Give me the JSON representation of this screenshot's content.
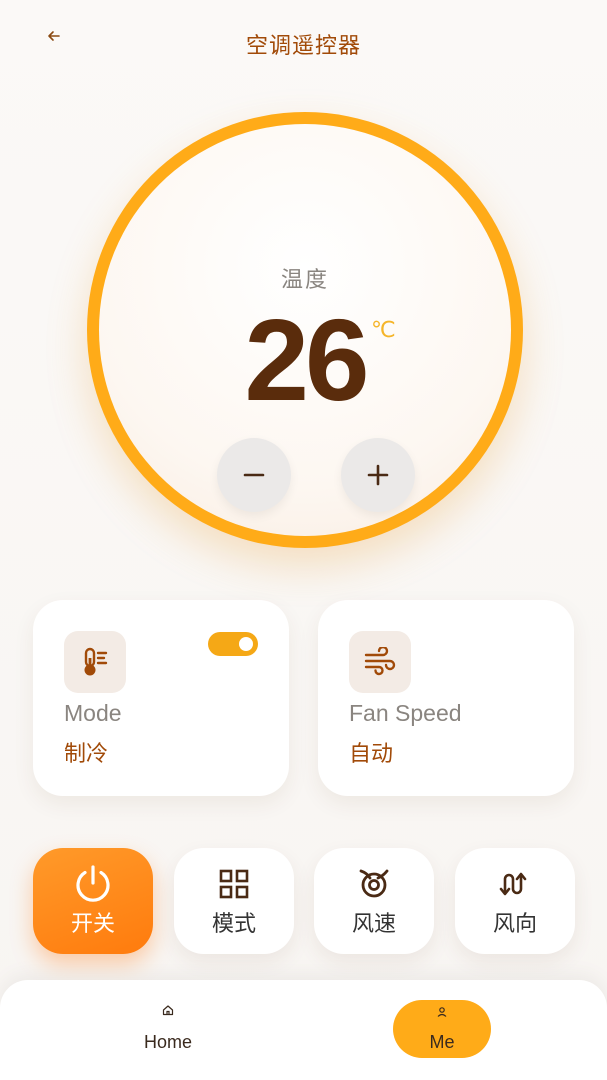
{
  "header": {
    "title": "空调遥控器",
    "back_icon": "arrow-left-icon"
  },
  "thermostat": {
    "label": "温度",
    "value": "26",
    "unit": "℃",
    "minus_label": "−",
    "plus_label": "+"
  },
  "cards": {
    "mode": {
      "title": "Mode",
      "value": "制冷",
      "icon": "thermometer-icon",
      "toggle_on": true
    },
    "fan_speed": {
      "title": "Fan Speed",
      "value": "自动",
      "icon": "wind-icon"
    }
  },
  "actions": [
    {
      "label": "开关",
      "icon": "power-icon",
      "active": true
    },
    {
      "label": "模式",
      "icon": "grid-icon"
    },
    {
      "label": "风速",
      "icon": "fan-icon"
    },
    {
      "label": "风向",
      "icon": "swing-direction-icon"
    }
  ],
  "nav": {
    "home_label": "Home",
    "me_label": "Me",
    "active": "Me"
  },
  "colors": {
    "accent": "#ffab18",
    "brand_brown": "#a14a08",
    "temp_text": "#5a2c0c",
    "power_orange": "#ff8a1a"
  }
}
